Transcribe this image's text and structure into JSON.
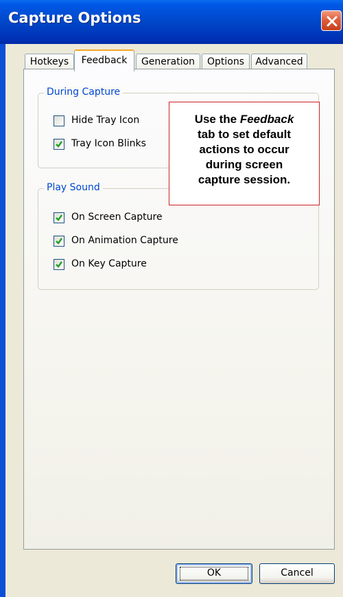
{
  "window": {
    "title": "Capture Options"
  },
  "tabs": [
    {
      "label": "Hotkeys"
    },
    {
      "label": "Feedback",
      "active": true
    },
    {
      "label": "Generation"
    },
    {
      "label": "Options"
    },
    {
      "label": "Advanced"
    }
  ],
  "during_capture": {
    "legend": "During Capture",
    "items": [
      {
        "label": "Hide Tray Icon",
        "checked": false
      },
      {
        "label": "Tray Icon Blinks",
        "checked": true
      }
    ]
  },
  "play_sound": {
    "legend": "Play Sound",
    "items": [
      {
        "label": "On Screen Capture",
        "checked": true
      },
      {
        "label": "On Animation Capture",
        "checked": true
      },
      {
        "label": "On Key Capture",
        "checked": true
      }
    ]
  },
  "callout": {
    "line1_prefix": "Use the ",
    "line1_emph": "Feedback",
    "line2": "tab to set default",
    "line3": "actions to occur",
    "line4": "during screen",
    "line5": "capture session."
  },
  "buttons": {
    "ok": "OK",
    "cancel": "Cancel"
  },
  "colors": {
    "title_bar": "#0047c8",
    "group_legend": "#0046d5",
    "callout_border": "#cc2222",
    "checkmark": "#21a121"
  }
}
